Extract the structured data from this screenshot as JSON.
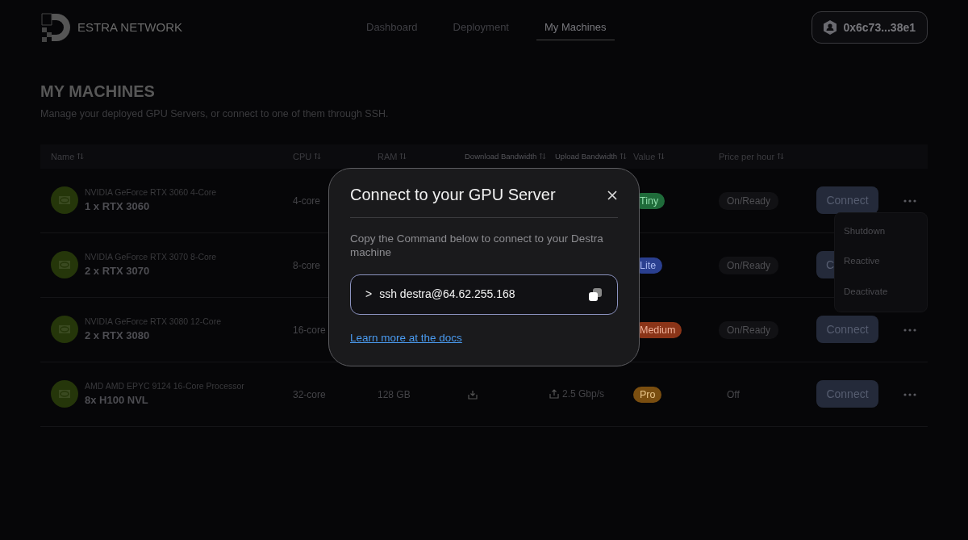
{
  "brand": {
    "name": "ESTRA NETWORK"
  },
  "nav": [
    {
      "label": "Dashboard",
      "selected": false
    },
    {
      "label": "Deployment",
      "selected": false
    },
    {
      "label": "My Machines",
      "selected": true
    }
  ],
  "wallet": {
    "address": "0x6c73...38e1"
  },
  "page": {
    "title": "MY MACHINES",
    "subtitle": "Manage your deployed GPU Servers, or connect to one of them through SSH."
  },
  "table": {
    "columns": [
      "Name",
      "CPU",
      "RAM",
      "Download Bandwidth",
      "Upload Bandwidth",
      "Value",
      "Price per hour"
    ],
    "rows": [
      {
        "model": "NVIDIA GeForce RTX 3060 4-Core",
        "gpu": "1 x RTX 3060",
        "cpu": "4-core",
        "tier": "Tiny",
        "color": "#1f6b3a",
        "status": "On/Ready",
        "on": true,
        "connect": "Connect"
      },
      {
        "model": "NVIDIA GeForce RTX 3070 8-Core",
        "gpu": "2 x RTX 3070",
        "cpu": "8-core",
        "tier": "Lite",
        "color": "#2a3f8f",
        "status": "On/Ready",
        "on": true,
        "connect": "C"
      },
      {
        "model": "NVIDIA GeForce RTX 3080 12-Core",
        "gpu": "2 x RTX 3080",
        "cpu": "16-core",
        "tier": "Medium",
        "color": "#8a3418",
        "status": "On/Ready",
        "on": true,
        "connect": "Connect"
      },
      {
        "model": "AMD AMD EPYC 9124 16-Core Processor",
        "gpu": "8x H100 NVL",
        "cpu": "32-core",
        "ram": "128 GB",
        "download": true,
        "upload": "2.5 Gbp/s",
        "tier": "Pro",
        "color": "#7a4e10",
        "status": "Off",
        "on": false,
        "connect": "Connect"
      }
    ]
  },
  "row_menu": {
    "items": [
      "Shutdown",
      "Reactive",
      "Deactivate"
    ]
  },
  "modal": {
    "title": "Connect to your GPU Server",
    "description": "Copy the Command below to connect to your Destra machine",
    "prompt": ">",
    "command": "ssh destra@64.62.255.168",
    "link": "Learn more at the docs"
  }
}
